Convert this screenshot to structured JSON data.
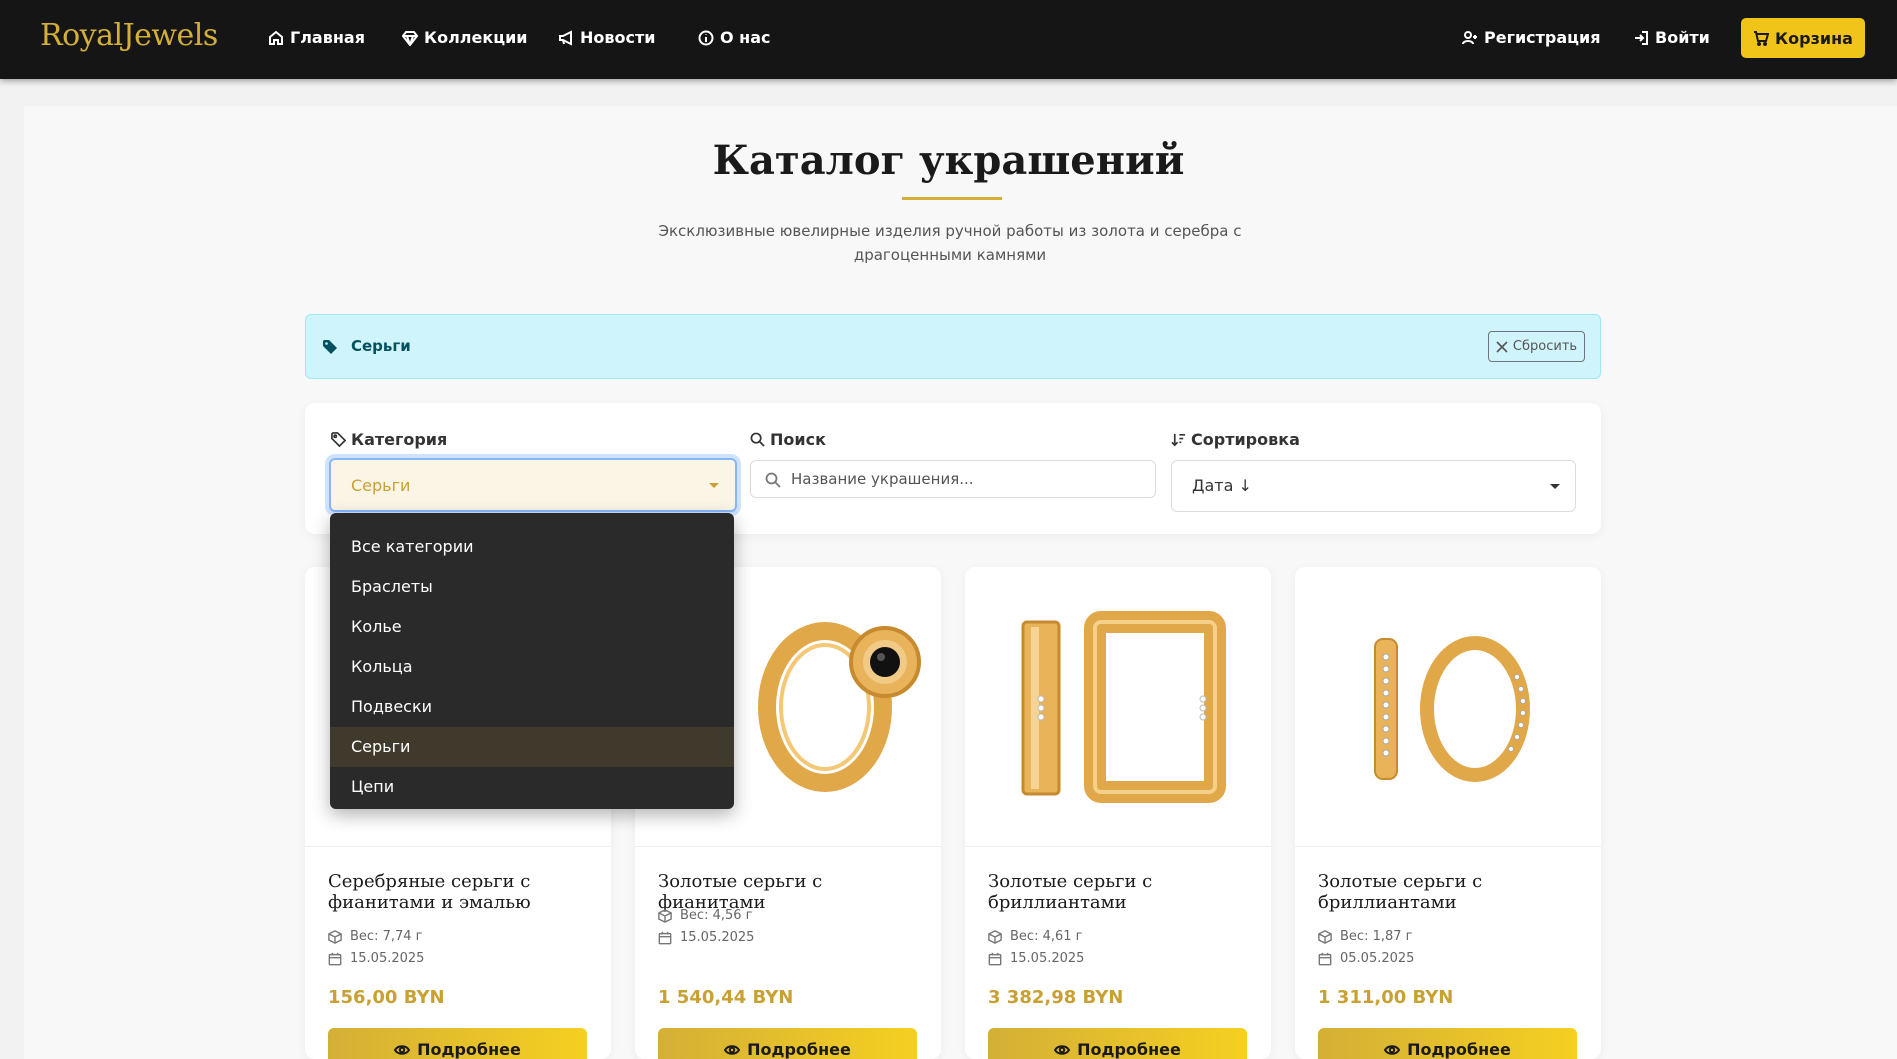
{
  "brand": "RoyalJewels",
  "nav": {
    "home": "Главная",
    "collections": "Коллекции",
    "news": "Новости",
    "about": "О нас",
    "register": "Регистрация",
    "login": "Войти",
    "cart": "Корзина"
  },
  "colors": {
    "accent": "#d4af37",
    "navbar": "#151515",
    "cart_button": "#f0c419",
    "alert_bg": "#cff4fc"
  },
  "header": {
    "title": "Каталог украшений",
    "subtitle": "Эксклюзивные ювелирные изделия ручной работы из золота и серебра с драгоценными камнями"
  },
  "active_filter": {
    "icon": "tag-icon",
    "label": "Серьги",
    "reset_label": "Сбросить"
  },
  "filters": {
    "category_label": "Категория",
    "category_value": "Серьги",
    "search_label": "Поиск",
    "search_placeholder": "Название украшения...",
    "sort_label": "Сортировка",
    "sort_value": "Дата ↓"
  },
  "category_options": [
    "Все категории",
    "Браслеты",
    "Колье",
    "Кольца",
    "Подвески",
    "Серьги",
    "Цепи"
  ],
  "products": [
    {
      "name": "Серебряные серьги с фианитами и эмалью",
      "weight": "Вес: 7,74 г",
      "date": "15.05.2025",
      "price": "156,00 BYN",
      "button": "Подробнее"
    },
    {
      "name": "Золотые серьги с фианитами",
      "weight": "Вес: 4,56 г",
      "date": "15.05.2025",
      "price": "1 540,44 BYN",
      "button": "Подробнее"
    },
    {
      "name": "Золотые серьги с бриллиантами",
      "weight": "Вес: 4,61 г",
      "date": "15.05.2025",
      "price": "3 382,98 BYN",
      "button": "Подробнее"
    },
    {
      "name": "Золотые серьги с бриллиантами",
      "weight": "Вес: 1,87 г",
      "date": "05.05.2025",
      "price": "1 311,00 BYN",
      "button": "Подробнее"
    }
  ]
}
